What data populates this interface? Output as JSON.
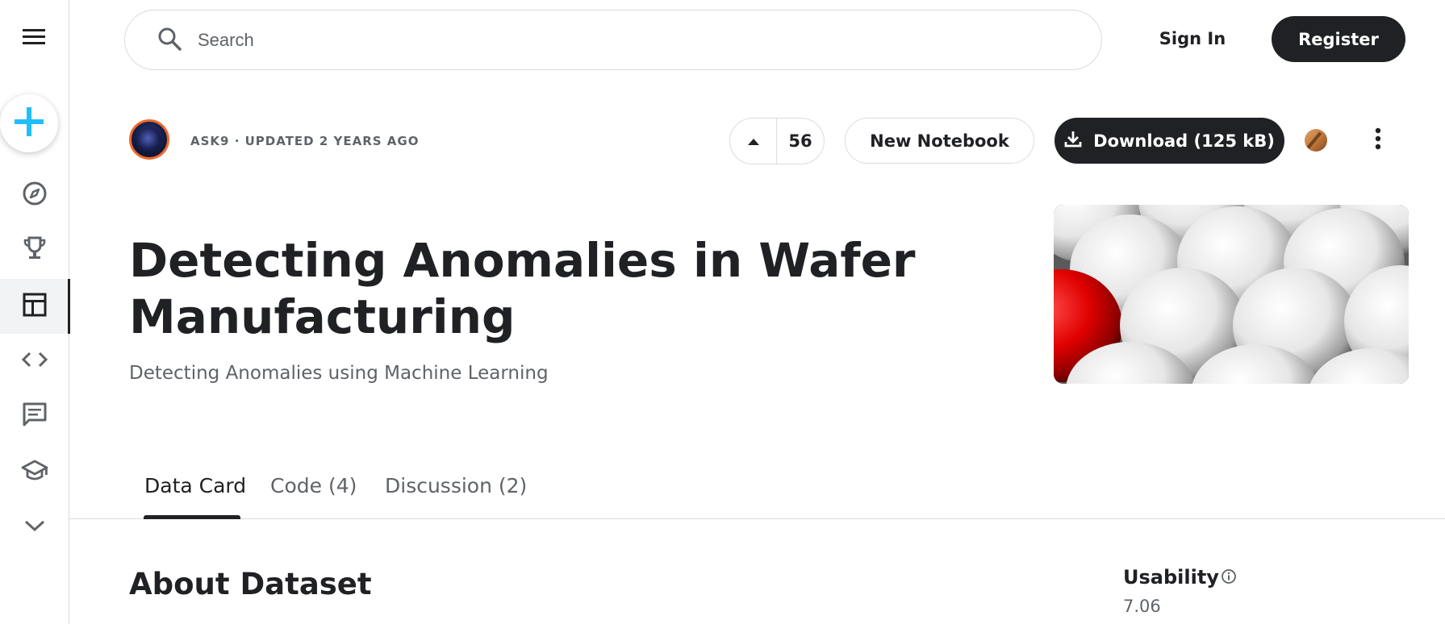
{
  "sidebar": {
    "menu_icon": "menu-icon",
    "create_icon": "plus-icon",
    "items": [
      {
        "name": "compass-icon",
        "label": "Explore"
      },
      {
        "name": "trophy-icon",
        "label": "Competitions"
      },
      {
        "name": "table-icon",
        "label": "Datasets",
        "active": true
      },
      {
        "name": "code-icon",
        "label": "Code"
      },
      {
        "name": "comment-icon",
        "label": "Discussions"
      },
      {
        "name": "school-icon",
        "label": "Learn"
      },
      {
        "name": "chevron-down-icon",
        "label": "More"
      }
    ]
  },
  "header": {
    "search_placeholder": "Search",
    "sign_in": "Sign In",
    "register": "Register"
  },
  "dataset": {
    "owner_line": "ASK9 · UPDATED 2 YEARS AGO",
    "vote_count": "56",
    "new_notebook": "New Notebook",
    "download": "Download (125 kB)",
    "title": "Detecting Anomalies in Wafer Manufacturing",
    "subtitle": "Detecting Anomalies using Machine Learning"
  },
  "tabs": [
    {
      "label": "Data Card",
      "active": true
    },
    {
      "label": "Code (4)",
      "active": false
    },
    {
      "label": "Discussion (2)",
      "active": false
    }
  ],
  "content": {
    "section_title": "About Dataset",
    "usability_label": "Usability",
    "usability_value": "7.06"
  },
  "colors": {
    "primary": "#202124",
    "secondary_text": "#5f6368",
    "accent_blue": "#20beff",
    "avatar_ring": "#f0682a"
  }
}
